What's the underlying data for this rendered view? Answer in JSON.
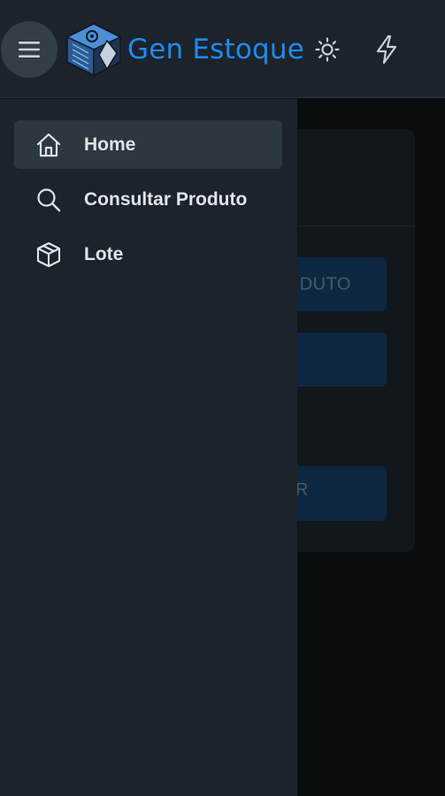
{
  "header": {
    "brand": "Gen Estoque",
    "menu_icon": "hamburger-menu-icon",
    "logo_icon": "cube-logo-icon",
    "theme_icon": "sun-icon",
    "bolt_icon": "lightning-bolt-icon"
  },
  "drawer": {
    "items": [
      {
        "label": "Home",
        "icon": "home-icon",
        "active": true
      },
      {
        "label": "Consultar Produto",
        "icon": "search-icon",
        "active": false
      },
      {
        "label": "Lote",
        "icon": "box-icon",
        "active": false
      }
    ]
  },
  "background": {
    "buttons": [
      {
        "label": "DUTO"
      },
      {
        "label": ""
      },
      {
        "label": "R"
      }
    ]
  },
  "colors": {
    "brand": "#1f8bf2",
    "header_bg": "#1c232a",
    "drawer_bg": "#1c232a",
    "active_item_bg": "#2c3740",
    "text": "#dfe4e8"
  }
}
